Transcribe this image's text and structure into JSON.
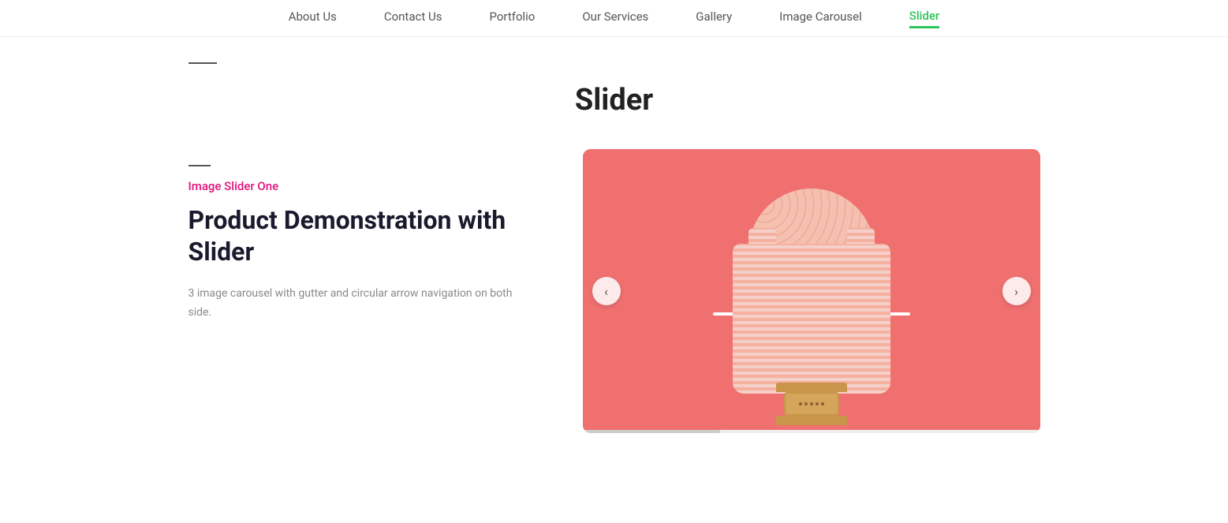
{
  "nav": {
    "items": [
      {
        "label": "About Us",
        "active": false
      },
      {
        "label": "Contact Us",
        "active": false
      },
      {
        "label": "Portfolio",
        "active": false
      },
      {
        "label": "Our Services",
        "active": false
      },
      {
        "label": "Gallery",
        "active": false
      },
      {
        "label": "Image Carousel",
        "active": false
      },
      {
        "label": "Slider",
        "active": true
      }
    ]
  },
  "page": {
    "title": "Slider"
  },
  "slider": {
    "subtitle": "Image Slider One",
    "heading": "Product Demonstration with Slider",
    "description": "3 image carousel with gutter and circular arrow navigation on both side.",
    "arrow_left": "‹",
    "arrow_right": "›"
  },
  "colors": {
    "active_nav": "#2dc35a",
    "subtitle": "#e0127c",
    "heading": "#1a1a2e",
    "carousel_bg": "#f07070"
  }
}
